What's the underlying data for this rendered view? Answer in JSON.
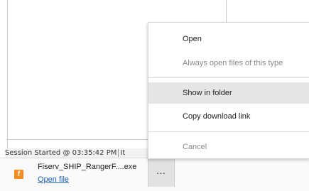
{
  "status": {
    "text": "Session Started @ 03:35:42 PM",
    "trailing_text": "It"
  },
  "download": {
    "icon": "installer-file-icon",
    "icon_letter": "f",
    "icon_color": "#f28b22",
    "file_name": "Fiserv_SHIP_RangerF....exe",
    "open_label": "Open file",
    "more_label": "…"
  },
  "context_menu": {
    "items": [
      {
        "label": "Open",
        "enabled": true
      },
      {
        "label": "Always open files of this type",
        "enabled": false
      },
      {
        "label": "Show in folder",
        "enabled": true,
        "highlighted": true
      },
      {
        "label": "Copy download link",
        "enabled": true
      },
      {
        "label": "Cancel",
        "enabled": false
      }
    ]
  }
}
